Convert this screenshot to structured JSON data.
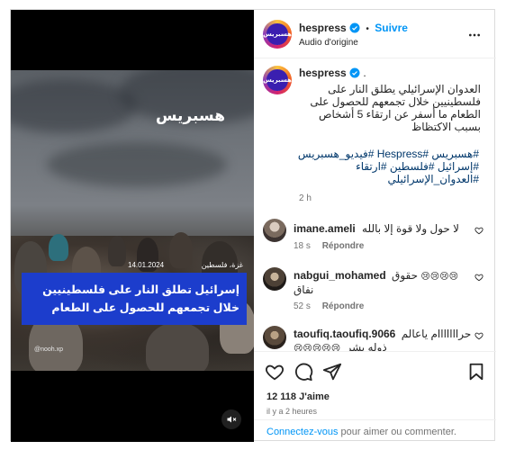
{
  "media": {
    "brand_logo": "هسبريس",
    "date": "14.01.2024",
    "location": "غزة، فلسطين",
    "caption_line1": "إسرائيل تطلق النار على فلسطينيين",
    "caption_line2": "خلال تجمعهم للحصول على الطعام",
    "credit": "@nooh.xp",
    "mute_icon": "speaker-muted-icon"
  },
  "header": {
    "username": "hespress",
    "follow_label": "Suivre",
    "separator": "•",
    "audio": "Audio d'origine",
    "avatar_text": "هسبريس"
  },
  "caption": {
    "username": "hespress",
    "dot": ".",
    "text_line1": "العدوان الإسرائيلي يطلق النار على",
    "text_line2": "فلسطينيين خلال تجمعهم للحصول على",
    "text_line3": "الطعام ما أسفر عن ارتقاء 5 أشخاص",
    "text_line4": "بسبب الاكتظاظ",
    "hashtags_line1": "#هسبريس #Hespress #فيديو_هسبريس",
    "hashtags_line2": "#إسرائيل #فلسطين #ارتقاء",
    "hashtags_line3": "#العدوان_الإسرائيلي",
    "time": "2 h"
  },
  "comments": [
    {
      "username": "imane.ameli",
      "text": "لا حول ولا قوة إلا بالله",
      "time": "18 s",
      "reply": "Répondre"
    },
    {
      "username": "nabgui_mohamed",
      "text_prefix": "حقوق",
      "emojis": "😢😢😢😢",
      "text_line2": "نفاق",
      "time": "52 s",
      "reply": "Répondre"
    },
    {
      "username": "taoufiq.taoufiq.9066",
      "text_line1": "حرااااااام ياعالم",
      "text_line2": "ذوله بشر",
      "emojis": "😢😢😢😢😢"
    }
  ],
  "actions": {
    "likes": "12 118 J'aime",
    "time_ago": "il y a 2 heures"
  },
  "login": {
    "link": "Connectez-vous",
    "rest": " pour aimer ou commenter."
  },
  "colors": {
    "accent": "#0095f6",
    "caption_box": "#1c3dcc",
    "hashtag": "#00376b"
  }
}
